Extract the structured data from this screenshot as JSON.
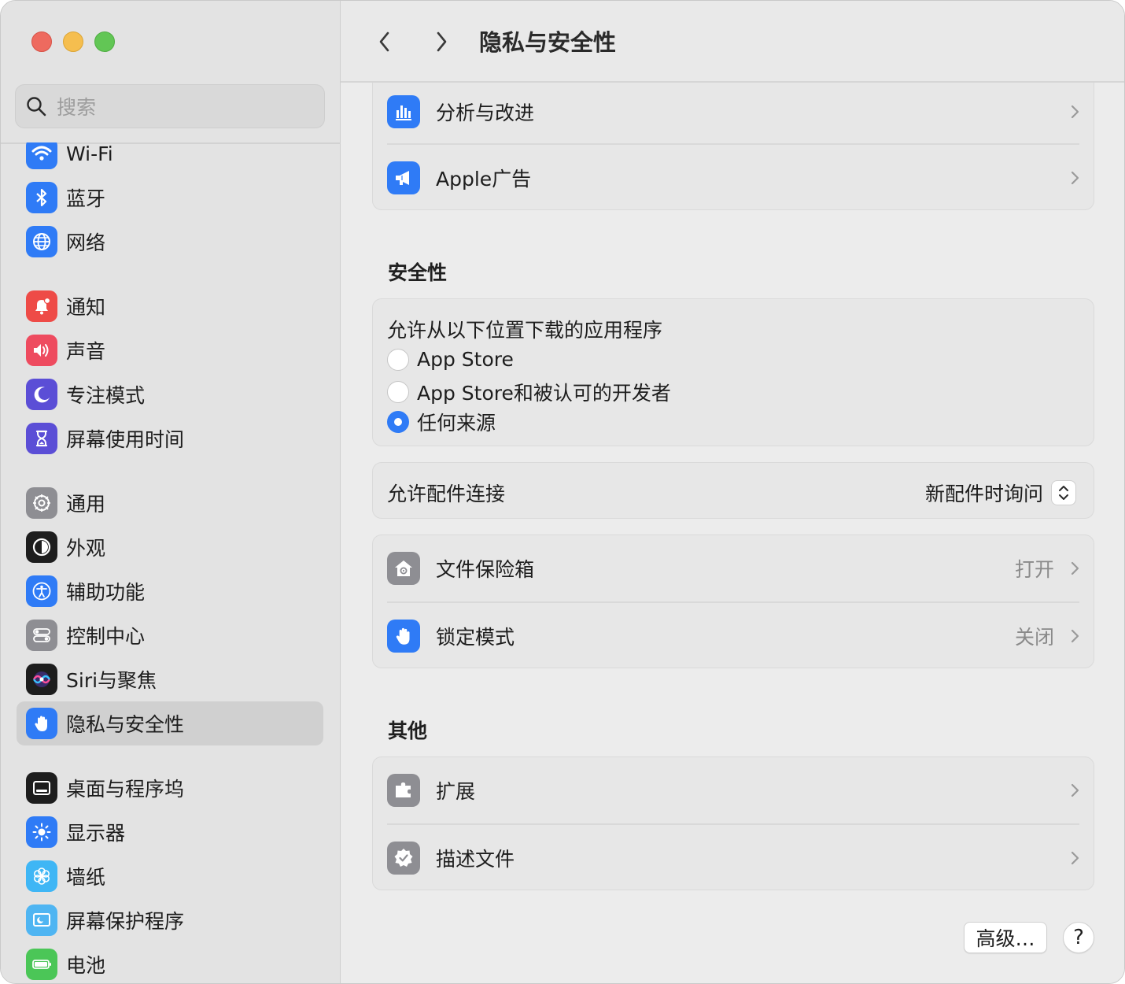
{
  "window": {
    "title": "隐私与安全性"
  },
  "search": {
    "placeholder": "搜索"
  },
  "sidebar": {
    "items": [
      {
        "label": "Wi-Fi",
        "icon": "wifi-icon",
        "color": "#2f7bf6"
      },
      {
        "label": "蓝牙",
        "icon": "bluetooth-icon",
        "color": "#2f7bf6"
      },
      {
        "label": "网络",
        "icon": "globe-icon",
        "color": "#2f7bf6"
      },
      {
        "label": "通知",
        "icon": "bell-icon",
        "color": "#ee4b47"
      },
      {
        "label": "声音",
        "icon": "speaker-icon",
        "color": "#ee4b5f"
      },
      {
        "label": "专注模式",
        "icon": "moon-icon",
        "color": "#5b4ed6"
      },
      {
        "label": "屏幕使用时间",
        "icon": "hourglass-icon",
        "color": "#5b4ed6"
      },
      {
        "label": "通用",
        "icon": "gear-icon",
        "color": "#8e8e93"
      },
      {
        "label": "外观",
        "icon": "appearance-icon",
        "color": "#1d1d1d"
      },
      {
        "label": "辅助功能",
        "icon": "accessibility-icon",
        "color": "#2f7bf6"
      },
      {
        "label": "控制中心",
        "icon": "toggles-icon",
        "color": "#8e8e93"
      },
      {
        "label": "Siri与聚焦",
        "icon": "siri-icon",
        "color": "#1d1d1d"
      },
      {
        "label": "隐私与安全性",
        "icon": "hand-icon",
        "color": "#2f7bf6",
        "active": true
      },
      {
        "label": "桌面与程序坞",
        "icon": "dock-icon",
        "color": "#1d1d1d"
      },
      {
        "label": "显示器",
        "icon": "sun-icon",
        "color": "#2f7bf6"
      },
      {
        "label": "墙纸",
        "icon": "flower-icon",
        "color": "#3fb6f5"
      },
      {
        "label": "屏幕保护程序",
        "icon": "screensaver-icon",
        "color": "#4fb5f2"
      },
      {
        "label": "电池",
        "icon": "battery-icon",
        "color": "#4bc657"
      }
    ]
  },
  "privacy_card": {
    "rows": [
      {
        "label": "分析与改进",
        "icon": "chart-bars-icon",
        "color": "#2f7bf6"
      },
      {
        "label": "Apple广告",
        "icon": "megaphone-icon",
        "color": "#2f7bf6"
      }
    ]
  },
  "security": {
    "heading": "安全性",
    "downloads_label": "允许从以下位置下载的应用程序",
    "options": [
      {
        "label": "App Store",
        "selected": false
      },
      {
        "label": "App Store和被认可的开发者",
        "selected": false
      },
      {
        "label": "任何来源",
        "selected": true
      }
    ],
    "accessory": {
      "label": "允许配件连接",
      "value": "新配件时询问"
    },
    "rows": [
      {
        "label": "文件保险箱",
        "value": "打开",
        "icon": "vault-icon",
        "color": "#8e8e93"
      },
      {
        "label": "锁定模式",
        "value": "关闭",
        "icon": "hand-icon",
        "color": "#2f7bf6"
      }
    ]
  },
  "others": {
    "heading": "其他",
    "rows": [
      {
        "label": "扩展",
        "icon": "puzzle-icon",
        "color": "#8e8e93"
      },
      {
        "label": "描述文件",
        "icon": "checkmark-badge-icon",
        "color": "#8e8e93"
      }
    ]
  },
  "footer": {
    "advanced_label": "高级…",
    "help_label": "?"
  }
}
